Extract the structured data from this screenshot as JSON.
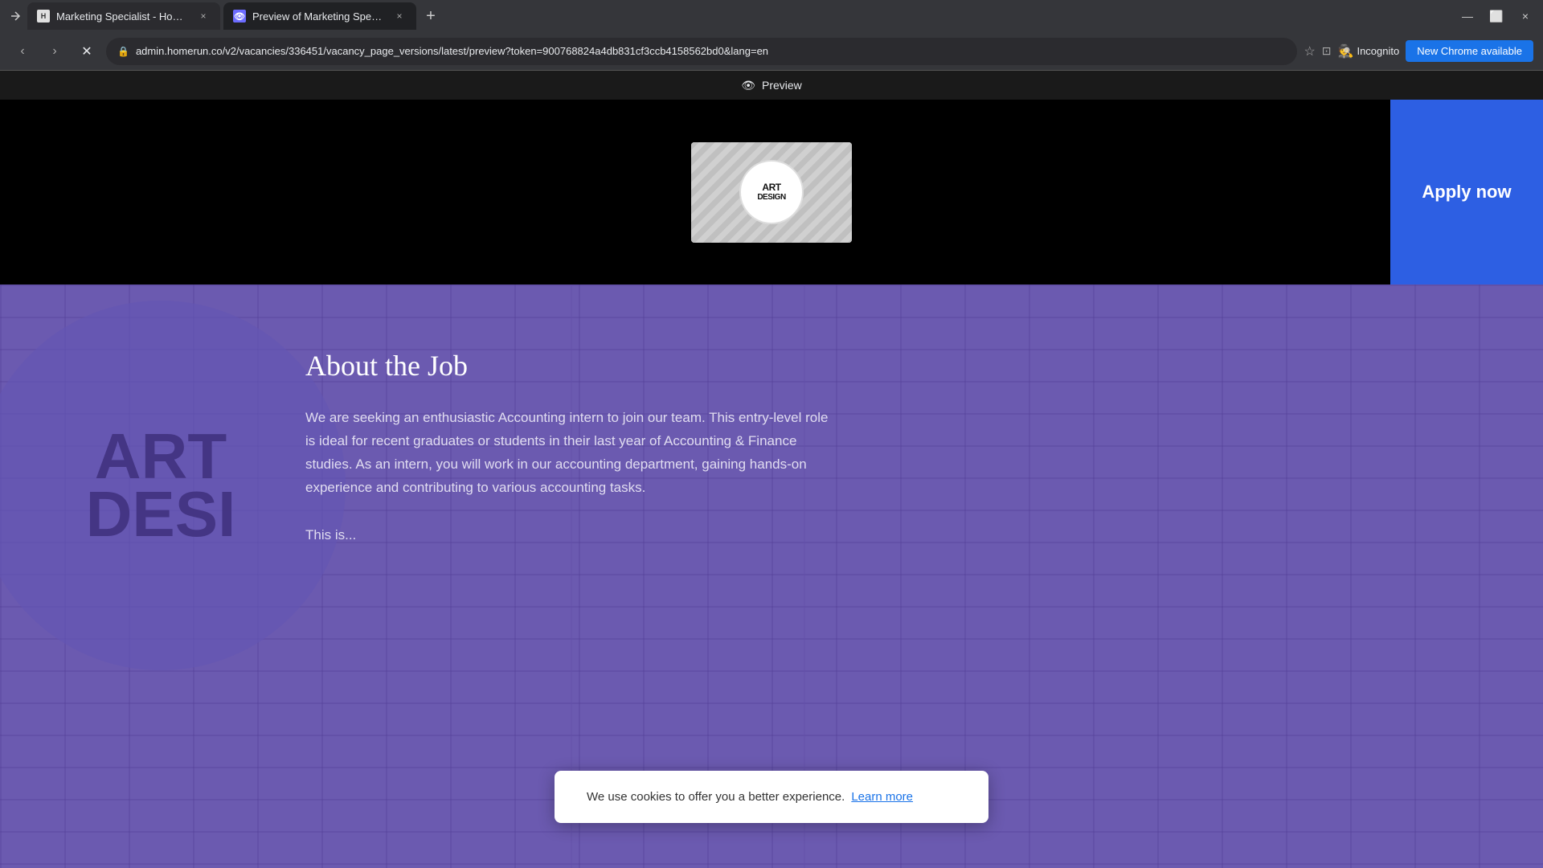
{
  "browser": {
    "tabs": [
      {
        "id": "tab1",
        "title": "Marketing Specialist - Homerun",
        "favicon": "H",
        "active": false
      },
      {
        "id": "tab2",
        "title": "Preview of Marketing Speciali...",
        "favicon": "👁",
        "active": true
      }
    ],
    "address_bar": {
      "url": "admin.homerun.co/v2/vacancies/336451/vacancy_page_versions/latest/preview?token=900768824a4db831cf3ccb4158562bd0&lang=en"
    },
    "controls": {
      "back": "‹",
      "forward": "›",
      "refresh": "✕",
      "bookmark": "☆",
      "incognito_label": "Incognito",
      "new_chrome_label": "New Chrome available"
    }
  },
  "preview_bar": {
    "label": "Preview"
  },
  "apply_button": {
    "label": "Apply now"
  },
  "hero": {
    "logo_line1": "ART",
    "logo_line2": "DESIGN"
  },
  "job_section": {
    "title": "About the Job",
    "description_1": "We are seeking an enthusiastic Accounting intern to join our team. This entry-level role is ideal for recent graduates or students in their last year of Accounting & Finance studies. As an intern, you will work in our accounting department, gaining hands-on experience and contributing to various accounting tasks.",
    "description_2": "This is..."
  },
  "cookie_banner": {
    "text": "We use cookies to offer you a better experience.",
    "link_text": "Learn more"
  },
  "watermark": {
    "line1": "ART",
    "line2": "DESI"
  }
}
